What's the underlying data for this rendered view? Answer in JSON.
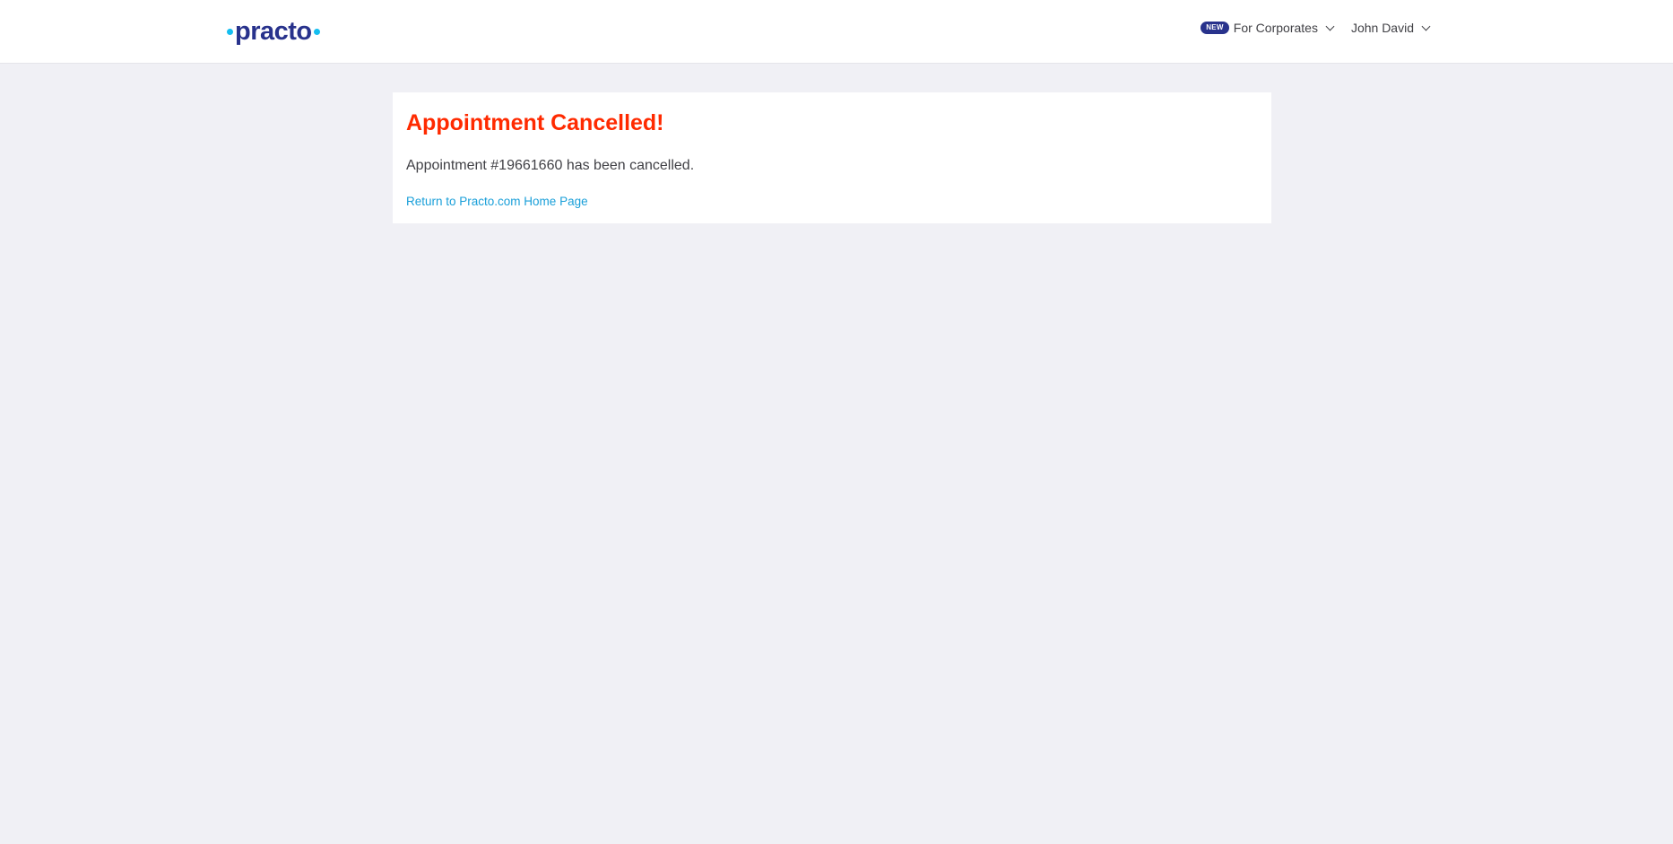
{
  "header": {
    "logo_text": "practo",
    "corporates": {
      "badge": "NEW",
      "label": "For Corporates"
    },
    "user": {
      "name": "John David"
    }
  },
  "main": {
    "title": "Appointment Cancelled!",
    "message": "Appointment #19661660 has been cancelled.",
    "home_link": "Return to Practo.com Home Page"
  },
  "colors": {
    "brand_navy": "#28328c",
    "brand_cyan": "#14bef0",
    "title_red": "#ff2a00",
    "link_blue": "#199fd9",
    "page_bg": "#f0f0f5"
  },
  "icons": {
    "dropdown": "chevron-down-icon"
  }
}
